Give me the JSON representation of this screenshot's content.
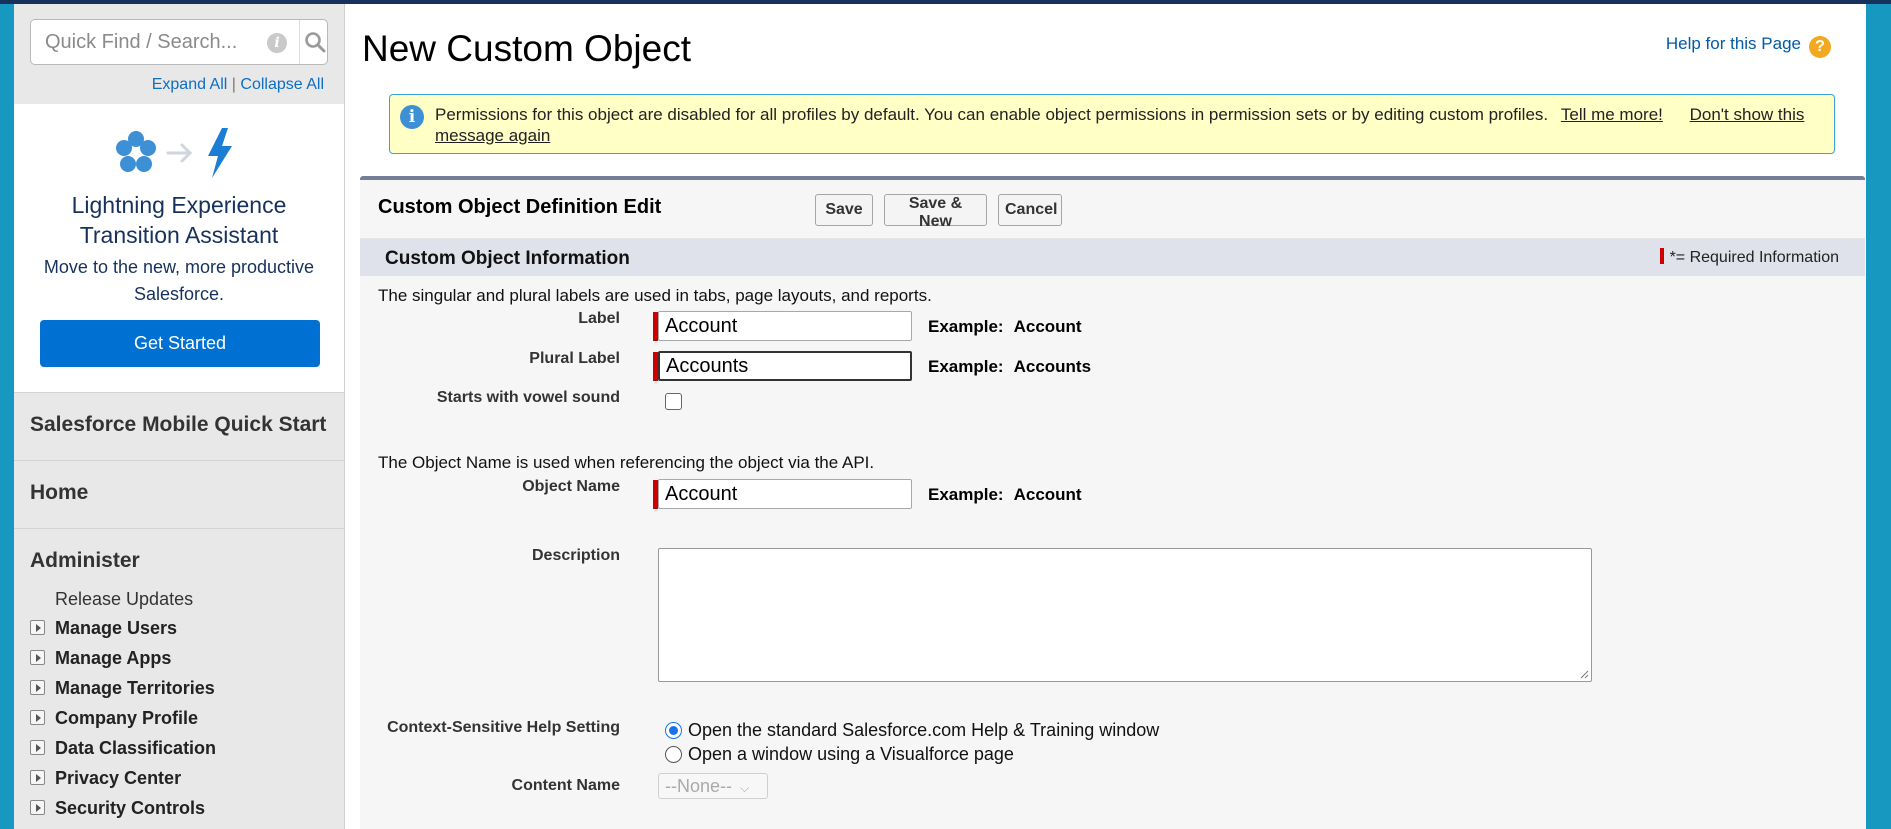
{
  "sidebar": {
    "search_placeholder": "Quick Find / Search...",
    "expand_all": "Expand All",
    "separator": "|",
    "collapse_all": "Collapse All",
    "lex": {
      "title_line1": "Lightning Experience",
      "title_line2": "Transition Assistant",
      "subtitle_line1": "Move to the new, more productive",
      "subtitle_line2": "Salesforce.",
      "button": "Get Started"
    },
    "sections": [
      "Salesforce Mobile Quick Start",
      "Home",
      "Administer"
    ],
    "release_updates": "Release Updates",
    "tree_items": [
      "Manage Users",
      "Manage Apps",
      "Manage Territories",
      "Company Profile",
      "Data Classification",
      "Privacy Center",
      "Security Controls"
    ]
  },
  "header": {
    "title": "New Custom Object",
    "help": "Help for this Page"
  },
  "message": {
    "text": "Permissions for this object are disabled for all profiles by default. You can enable object permissions in permission sets or by editing custom profiles.",
    "tell_more": "Tell me more!",
    "dismiss": "Don't show this message again"
  },
  "form": {
    "title": "Custom Object Definition Edit",
    "save": "Save",
    "save_new": "Save & New",
    "cancel": "Cancel",
    "section": "Custom Object Information",
    "required_info": "*= Required Information",
    "labels_help": "The singular and plural labels are used in tabs, page layouts, and reports.",
    "label": {
      "label": "Label",
      "value": "Account",
      "example_label": "Example:",
      "example": "Account"
    },
    "plural": {
      "label": "Plural Label",
      "value": "Accounts",
      "example_label": "Example:",
      "example": "Accounts"
    },
    "vowel": {
      "label": "Starts with vowel sound",
      "checked": false
    },
    "api_help": "The Object Name is used when referencing the object via the API.",
    "object_name": {
      "label": "Object Name",
      "value": "Account",
      "example_label": "Example:",
      "example": "Account"
    },
    "description": {
      "label": "Description",
      "value": ""
    },
    "help_setting": {
      "label": "Context-Sensitive Help Setting",
      "option1": "Open the standard Salesforce.com Help & Training window",
      "option2": "Open a window using a Visualforce page",
      "selected": "option1"
    },
    "content_name": {
      "label": "Content Name",
      "value": "--None--"
    }
  },
  "colors": {
    "accent": "#0070d2",
    "required": "#cc0000",
    "sidebar_bg": "#e8e8e8",
    "message_bg": "#ffffc6",
    "section_bg": "#dfe2ea",
    "desktop_bg": "#1798c1"
  }
}
